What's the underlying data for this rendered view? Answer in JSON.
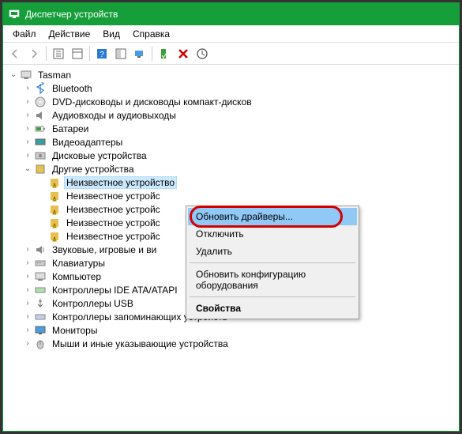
{
  "title": "Диспетчер устройств",
  "menu": {
    "file": "Файл",
    "action": "Действие",
    "view": "Вид",
    "help": "Справка"
  },
  "tree": {
    "root": "Tasman",
    "bluetooth": "Bluetooth",
    "dvd": "DVD-дисководы и дисководы компакт-дисков",
    "audio": "Аудиовходы и аудиовыходы",
    "battery": "Батареи",
    "video": "Видеоадаптеры",
    "disk": "Дисковые устройства",
    "other": "Другие устройства",
    "unknown1": "Неизвестное устройство",
    "unknown2": "Неизвестное устройс",
    "unknown3": "Неизвестное устройс",
    "unknown4": "Неизвестное устройс",
    "unknown5": "Неизвестное устройс",
    "sound": "Звуковые, игровые и ви",
    "keyboard": "Клавиатуры",
    "computer": "Компьютер",
    "ide": "Контроллеры IDE ATA/ATAPI",
    "usb": "Контроллеры USB",
    "storage": "Контроллеры запоминающих устройств",
    "monitor": "Мониторы",
    "mouse": "Мыши и иные указывающие устройства"
  },
  "context": {
    "update": "Обновить драйверы...",
    "disable": "Отключить",
    "delete": "Удалить",
    "scan": "Обновить конфигурацию оборудования",
    "props": "Свойства"
  }
}
